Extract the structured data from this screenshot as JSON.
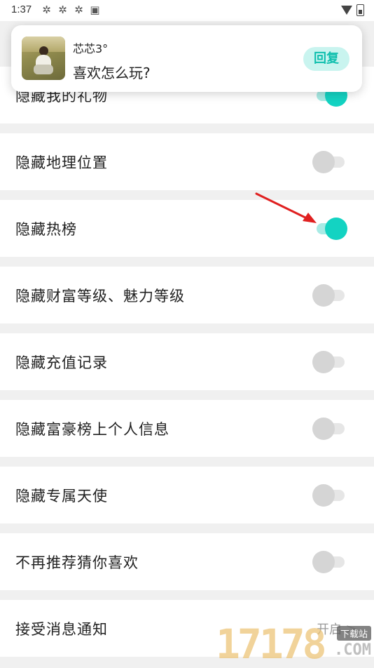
{
  "status_bar": {
    "time": "1:37",
    "notification_icons": [
      "app-icon",
      "app-icon",
      "app-icon",
      "a-icon"
    ],
    "right_icons": [
      "wifi-icon",
      "battery-icon"
    ]
  },
  "notification": {
    "sender": "芯芯3°",
    "message": "喜欢怎么玩?",
    "reply_label": "回复"
  },
  "settings": [
    {
      "label": "隐藏我的礼物",
      "on": true
    },
    {
      "label": "隐藏地理位置",
      "on": false
    },
    {
      "label": "隐藏热榜",
      "on": true
    },
    {
      "label": "隐藏财富等级、魅力等级",
      "on": false
    },
    {
      "label": "隐藏充值记录",
      "on": false
    },
    {
      "label": "隐藏富豪榜上个人信息",
      "on": false
    },
    {
      "label": "隐藏专属天使",
      "on": false
    },
    {
      "label": "不再推荐猜你喜欢",
      "on": false
    }
  ],
  "notification_settings": {
    "label": "接受消息通知",
    "value": "开启",
    "chevron": ">"
  },
  "watermark": {
    "digits": "17178",
    "site_label": "下载站",
    "domain": ".COM"
  },
  "colors": {
    "accent": "#13d3c2",
    "accent_track": "#a8ebe5",
    "toggle_off_knob": "#d5d5d5",
    "toggle_off_track": "#e6e6e6",
    "reply_bg": "#c9f4ef",
    "reply_text": "#10bfae",
    "annotation_arrow": "#e02020"
  }
}
